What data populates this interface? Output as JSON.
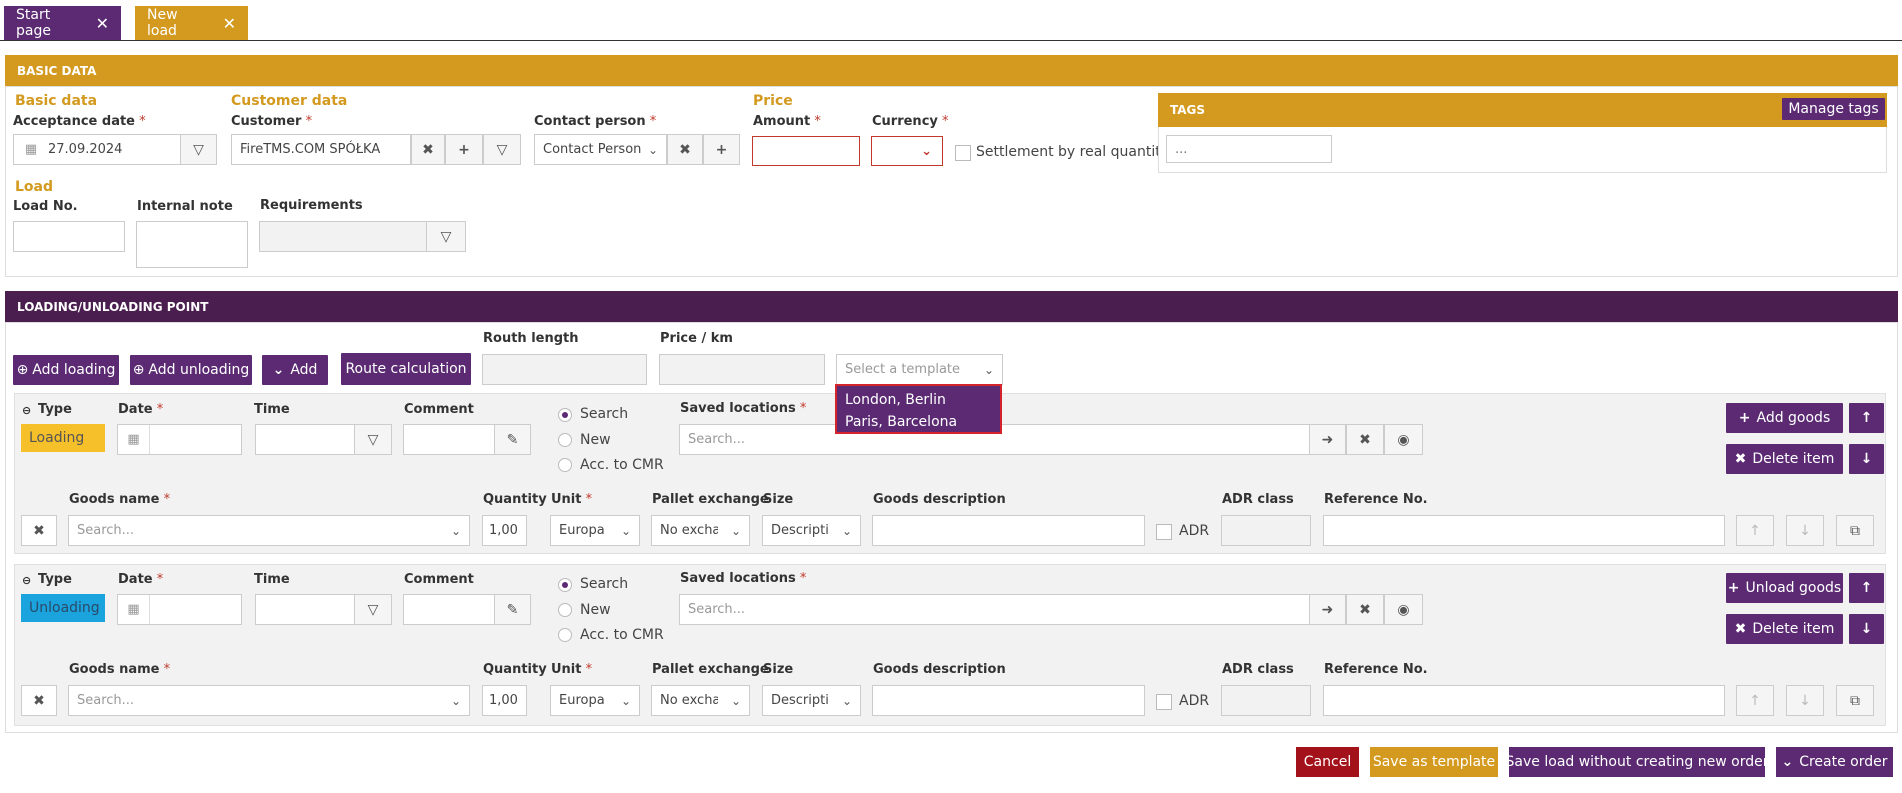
{
  "tabs": [
    {
      "label": "Start page",
      "close": "✕"
    },
    {
      "label": "New load",
      "close": "✕"
    }
  ],
  "colors": {
    "purple": "#5b2a73",
    "orange": "#d39a1f",
    "dark_purple": "#4a1e4e",
    "loading": "#f6c02b",
    "unloading": "#1aa3dc",
    "cancel": "#a3111a"
  },
  "basic": {
    "header": "BASIC DATA",
    "section_basic": "Basic data",
    "acceptance_label": "Acceptance date",
    "acceptance_value": "27.09.2024",
    "section_customer": "Customer data",
    "customer_label": "Customer",
    "customer_value": "FireTMS.COM SPÓŁKA",
    "contact_label": "Contact person",
    "contact_placeholder": "Contact Person",
    "section_price": "Price",
    "amount_label": "Amount",
    "currency_label": "Currency",
    "settlement_label": "Settlement by real quantity",
    "section_load": "Load",
    "loadno_label": "Load No.",
    "note_label": "Internal note",
    "req_label": "Requirements",
    "tags_header": "TAGS",
    "manage_tags": "Manage tags",
    "tags_placeholder": "..."
  },
  "points": {
    "header": "LOADING/UNLOADING POINT",
    "add_loading": "Add loading",
    "add_unloading": "Add unloading",
    "add": "Add",
    "route_calc": "Route calculation",
    "routh_length_label": "Routh length",
    "price_km_label": "Price / km",
    "template_placeholder": "Select a template",
    "template_options": [
      "London, Berlin",
      "Paris, Barcelona"
    ]
  },
  "rows": [
    {
      "type_label": "Type",
      "type_value": "Loading",
      "date_label": "Date",
      "time_label": "Time",
      "comment_label": "Comment",
      "radio": [
        "Search",
        "New",
        "Acc. to CMR"
      ],
      "saved_label": "Saved locations",
      "saved_placeholder": "Search...",
      "goods_btn": "Add goods",
      "delete_btn": "Delete item",
      "goods_name_label": "Goods name",
      "goods_placeholder": "Search...",
      "qty_label": "Quantity",
      "qty_value": "1,00",
      "unit_label": "Unit",
      "unit_value": "Europa",
      "pallet_label": "Pallet exchange",
      "pallet_value": "No exchange",
      "size_label": "Size",
      "size_value": "Description",
      "desc_label": "Goods description",
      "adr": "ADR",
      "adr_class_label": "ADR class",
      "ref_label": "Reference No."
    },
    {
      "type_label": "Type",
      "type_value": "Unloading",
      "date_label": "Date",
      "time_label": "Time",
      "comment_label": "Comment",
      "radio": [
        "Search",
        "New",
        "Acc. to CMR"
      ],
      "saved_label": "Saved locations",
      "saved_placeholder": "Search...",
      "goods_btn": "Unload goods",
      "delete_btn": "Delete item",
      "goods_name_label": "Goods name",
      "goods_placeholder": "Search...",
      "qty_label": "Quantity",
      "qty_value": "1,00",
      "unit_label": "Unit",
      "unit_value": "Europa",
      "pallet_label": "Pallet exchange",
      "pallet_value": "No exchange",
      "size_label": "Size",
      "size_value": "Description",
      "desc_label": "Goods description",
      "adr": "ADR",
      "adr_class_label": "ADR class",
      "ref_label": "Reference No."
    }
  ],
  "footer": {
    "cancel": "Cancel",
    "save_template": "Save as template",
    "save_load": "Save load without creating new order",
    "create_order": "Create order"
  }
}
